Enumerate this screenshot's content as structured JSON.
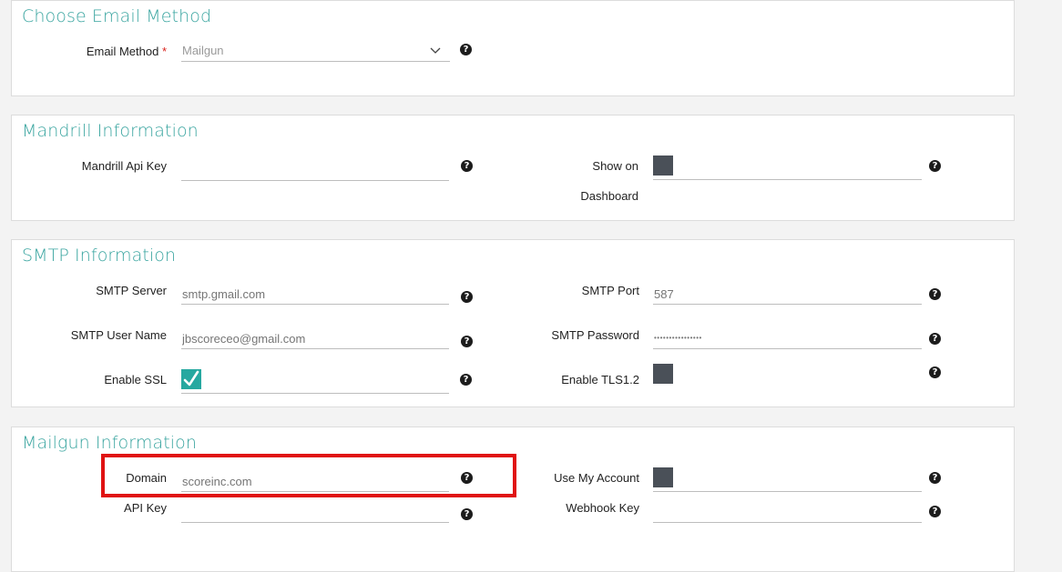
{
  "email_method_section": {
    "title": "Choose Email Method",
    "email_method_label": "Email Method",
    "required_marker": "*",
    "email_method_value": "Mailgun"
  },
  "mandrill_section": {
    "title": "Mandrill Information",
    "api_key_label": "Mandrill Api Key",
    "api_key_value": "",
    "show_on_dashboard_label_line1": "Show on",
    "show_on_dashboard_label_line2": "Dashboard",
    "show_on_dashboard_checked": false
  },
  "smtp_section": {
    "title": "SMTP Information",
    "server_label": "SMTP Server",
    "server_placeholder": "smtp.gmail.com",
    "port_label": "SMTP Port",
    "port_placeholder": "587",
    "user_label": "SMTP User Name",
    "user_placeholder": "jbscoreceo@gmail.com",
    "password_label": "SMTP Password",
    "password_value": "••••••••••••••••",
    "ssl_label": "Enable SSL",
    "ssl_checked": true,
    "tls_label": "Enable TLS1.2",
    "tls_checked": false
  },
  "mailgun_section": {
    "title": "Mailgun Information",
    "domain_label": "Domain",
    "domain_placeholder": "scoreinc.com",
    "use_my_account_label": "Use My Account",
    "use_my_account_checked": false,
    "api_key_label": "API Key",
    "api_key_value": "",
    "webhook_key_label": "Webhook Key",
    "webhook_key_value": ""
  },
  "help_glyph": "?",
  "icons": {
    "help": "question-circle-icon",
    "dropdown": "chevron-down-icon",
    "checkmark": "checkmark-icon"
  },
  "colors": {
    "accent": "#3aa5a0",
    "checkbox_on": "#26a8a0",
    "checkbox_off": "#4a5058",
    "required": "#d9231d",
    "highlight": "#e01212"
  }
}
